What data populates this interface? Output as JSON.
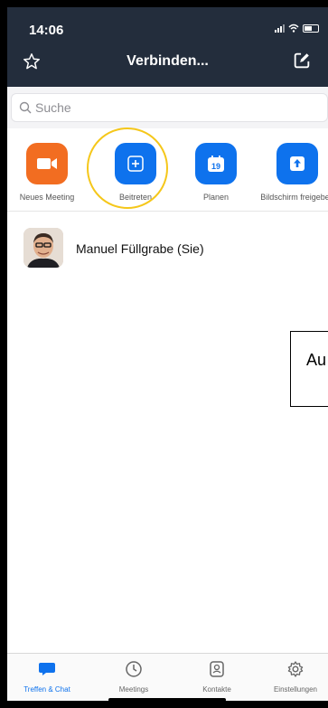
{
  "status": {
    "time": "14:06"
  },
  "nav": {
    "title": "Verbinden...",
    "favorite_icon": "star-icon",
    "edit_icon": "edit-icon"
  },
  "search": {
    "placeholder": "Suche"
  },
  "actions": [
    {
      "label": "Neues Meeting",
      "icon": "video-camera-icon",
      "color": "#f26d21"
    },
    {
      "label": "Beitreten",
      "icon": "plus-icon",
      "color": "#0e72ed"
    },
    {
      "label": "Planen",
      "icon": "calendar-icon",
      "color": "#0e72ed",
      "calendar_day": "19"
    },
    {
      "label": "Bildschirm freigeben",
      "icon": "share-screen-icon",
      "color": "#0e72ed"
    }
  ],
  "contact": {
    "name": "Manuel Füllgrabe (Sie)"
  },
  "note": {
    "text": "Au"
  },
  "tabs": [
    {
      "label": "Treffen & Chat",
      "icon": "chat-icon",
      "active": true
    },
    {
      "label": "Meetings",
      "icon": "clock-icon"
    },
    {
      "label": "Kontakte",
      "icon": "contacts-icon"
    },
    {
      "label": "Einstellungen",
      "icon": "gear-icon"
    }
  ],
  "colors": {
    "header_bg": "#232d3c",
    "accent": "#0e72ed",
    "highlight": "#f5c71a"
  }
}
